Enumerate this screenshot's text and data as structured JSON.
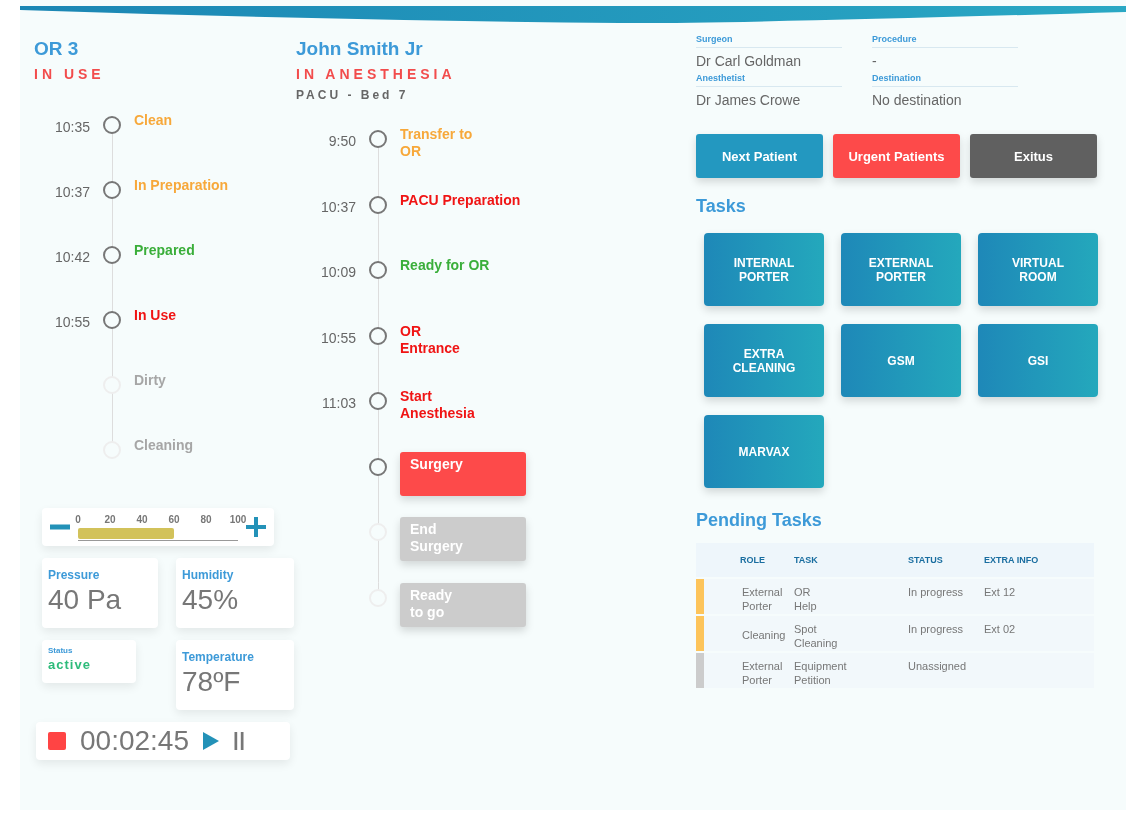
{
  "room": {
    "name": "OR 3",
    "status": "IN USE"
  },
  "room_timeline": [
    {
      "time": "10:35",
      "label": "Clean",
      "color": "#f7a83a",
      "done": true
    },
    {
      "time": "10:37",
      "label": "In Preparation",
      "color": "#f7a83a",
      "done": true
    },
    {
      "time": "10:42",
      "label": "Prepared",
      "color": "#3aae3a",
      "done": true
    },
    {
      "time": "10:55",
      "label": "In Use",
      "color": "#f01414",
      "done": true
    },
    {
      "label": "Dirty",
      "color": "#a6a6a6",
      "done": false
    },
    {
      "label": "Cleaning",
      "color": "#a6a6a6",
      "done": false
    }
  ],
  "patient": {
    "name": "John Smith Jr",
    "status": "IN ANESTHESIA",
    "location": "PACU - Bed 7"
  },
  "patient_timeline": [
    {
      "kind": "text",
      "time": "9:50",
      "label": "Transfer to\nOR",
      "color": "#f7a83a",
      "done": true
    },
    {
      "kind": "text",
      "time": "10:37",
      "label": "PACU Preparation",
      "color": "#f01414",
      "done": true
    },
    {
      "kind": "text",
      "time": "10:09",
      "label": "Ready for OR",
      "color": "#3aae3a",
      "done": true
    },
    {
      "kind": "text",
      "time": "10:55",
      "label": "OR\nEntrance",
      "color": "#f01414",
      "done": true
    },
    {
      "kind": "text",
      "time": "11:03",
      "label": "Start\nAnesthesia",
      "color": "#f01414",
      "done": true
    },
    {
      "kind": "pill",
      "label": "Surgery",
      "color": "#fd4a4a",
      "done": true
    },
    {
      "kind": "pill",
      "label": "End\nSurgery",
      "color": "#cccccc",
      "done": false
    },
    {
      "kind": "pill",
      "label": "Ready\nto go",
      "color": "#cccccc",
      "done": false
    }
  ],
  "gauge": {
    "ticks": [
      "0",
      "20",
      "40",
      "60",
      "80",
      "100"
    ],
    "level": 0.6
  },
  "sensors": [
    {
      "kind": "metric",
      "label": "Pressure",
      "value": "40 Pa"
    },
    {
      "kind": "metric",
      "label": "Humidity",
      "value": "45%"
    },
    {
      "kind": "status",
      "label": "Status",
      "value": "active"
    },
    {
      "kind": "metric",
      "label": "Temperature",
      "value": "78ºF"
    }
  ],
  "timer": {
    "time": "00:02:45"
  },
  "details": [
    {
      "label": "Surgeon",
      "value": "Dr Carl Goldman"
    },
    {
      "label": "Procedure",
      "value": "-"
    },
    {
      "label": "Anesthetist",
      "value": "Dr James Crowe"
    },
    {
      "label": "Destination",
      "value": "No destination"
    }
  ],
  "actions": [
    {
      "label": "Next Patient",
      "color": "#2398c0"
    },
    {
      "label": "Urgent Patients",
      "color": "#fd4a4a"
    },
    {
      "label": "Exitus",
      "color": "#606060"
    }
  ],
  "tasks": {
    "title": "Tasks",
    "items": [
      "INTERNAL\nPORTER",
      "EXTERNAL\nPORTER",
      "VIRTUAL\nROOM",
      "EXTRA\nCLEANING",
      "GSM",
      "GSI",
      "MARVAX"
    ]
  },
  "pending_tasks": {
    "title": "Pending Tasks",
    "columns": [
      "ROLE",
      "TASK",
      "STATUS",
      "EXTRA INFO"
    ],
    "rows": [
      {
        "color": "#fdc45a",
        "cells": [
          "External\nPorter",
          "OR\nHelp",
          "In progress",
          "Ext 12"
        ]
      },
      {
        "color": "#fdc45a",
        "cells": [
          "Cleaning",
          "Spot\nCleaning",
          "In progress",
          "Ext 02"
        ]
      },
      {
        "color": "#cccccc",
        "cells": [
          "External\nPorter",
          "Equipment\nPetition",
          "Unassigned"
        ]
      }
    ]
  }
}
